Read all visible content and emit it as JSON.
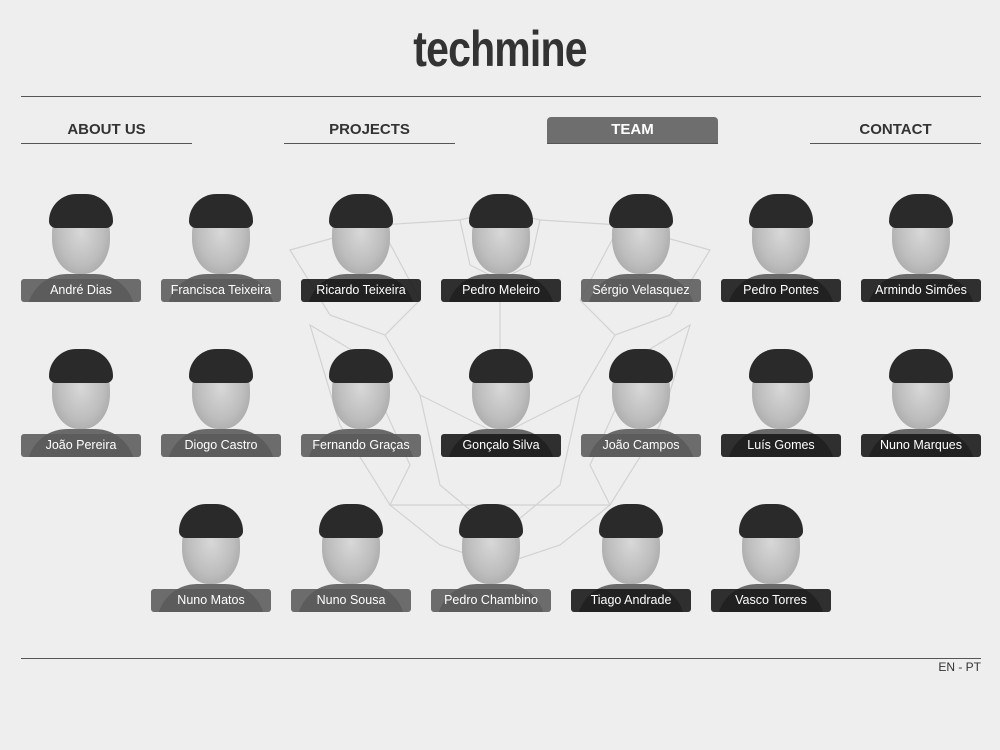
{
  "brand": {
    "logo_text": "techmine"
  },
  "nav": [
    {
      "label": "ABOUT US",
      "active": false
    },
    {
      "label": "PROJECTS",
      "active": false
    },
    {
      "label": "TEAM",
      "active": true
    },
    {
      "label": "CONTACT",
      "active": false
    }
  ],
  "team": {
    "rows": [
      [
        "André Dias",
        "Francisca Teixeira",
        "Ricardo Teixeira",
        "Pedro Meleiro",
        "Sérgio Velasquez",
        "Pedro Pontes",
        "Armindo Simões"
      ],
      [
        "João Pereira",
        "Diogo Castro",
        "Fernando Graças",
        "Gonçalo Silva",
        "João Campos",
        "Luís Gomes",
        "Nuno Marques"
      ],
      [
        "Nuno Matos",
        "Nuno Sousa",
        "Pedro Chambino",
        "Tiago Andrade",
        "Vasco Torres"
      ]
    ]
  },
  "footer": {
    "lang_en": "EN",
    "lang_sep": " - ",
    "lang_pt": "PT"
  },
  "colors": {
    "background": "#eeeeee",
    "text": "#333333",
    "active_tab": "#6e6e6e"
  }
}
